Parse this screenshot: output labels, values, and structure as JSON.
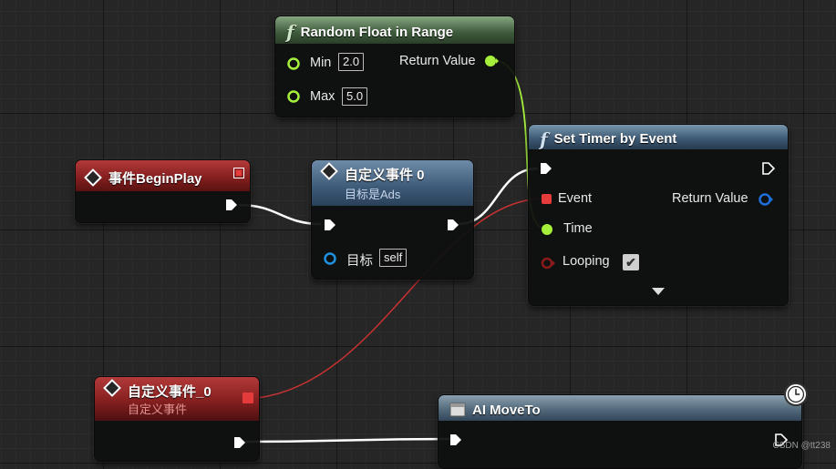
{
  "nodes": {
    "random_float": {
      "title": "Random Float in Range",
      "min_label": "Min",
      "min_value": "2.0",
      "max_label": "Max",
      "max_value": "5.0",
      "return_label": "Return Value"
    },
    "set_timer": {
      "title": "Set Timer by Event",
      "event_label": "Event",
      "return_label": "Return Value",
      "time_label": "Time",
      "looping_label": "Looping",
      "looping_checked": true
    },
    "begin_play": {
      "title": "事件BeginPlay"
    },
    "custom_event_call": {
      "title": "自定义事件 0",
      "subtitle": "目标是Ads",
      "target_label": "目标",
      "target_value": "self"
    },
    "custom_event_def": {
      "title": "自定义事件_0",
      "subtitle": "自定义事件"
    },
    "ai_move_to": {
      "title": "AI MoveTo"
    }
  },
  "watermark": "CSDN @tt238",
  "colors": {
    "exec_wire": "#ffffff",
    "float_wire": "#a6f03c",
    "delegate_wire": "#c83232",
    "object_pin": "#1e90e0"
  }
}
